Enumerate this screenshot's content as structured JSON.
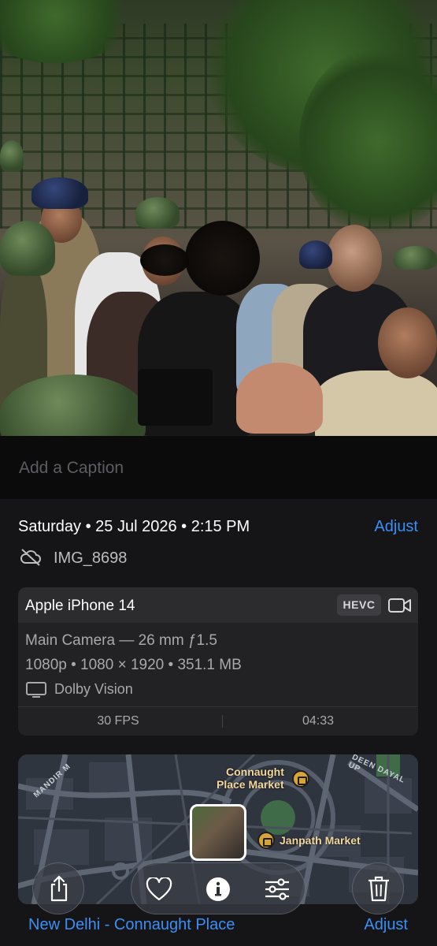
{
  "caption": {
    "placeholder": "Add a Caption"
  },
  "metadata": {
    "date_line": "Saturday • 25 Jul 2026 • 2:15 PM",
    "adjust_label": "Adjust",
    "filename": "IMG_8698",
    "cloud_icon": "cloud-slash-icon"
  },
  "camera": {
    "device": "Apple iPhone 14",
    "format_badge": "HEVC",
    "lens": "Main Camera — 26 mm ƒ1.5",
    "resolution": "1080p • 1080 × 1920 • 351.1 MB",
    "hdr": "Dolby Vision",
    "fps": "30 FPS",
    "duration": "04:33"
  },
  "map": {
    "labels": {
      "connaught_line1": "Connaught",
      "connaught_line2": "Place Market",
      "janpath": "Janpath Market",
      "street_mandir": "MANDIR M",
      "street_deen": "DEEN DAYAL UP"
    }
  },
  "location": {
    "name": "New Delhi - Connaught Place",
    "adjust_label": "Adjust"
  },
  "toolbar": {
    "share_icon": "share-icon",
    "favorite_icon": "heart-icon",
    "info_icon": "info-icon",
    "edit_icon": "sliders-icon",
    "delete_icon": "trash-icon"
  },
  "colors": {
    "accent": "#3a8ff6",
    "background": "#151517",
    "card": "#222225"
  }
}
